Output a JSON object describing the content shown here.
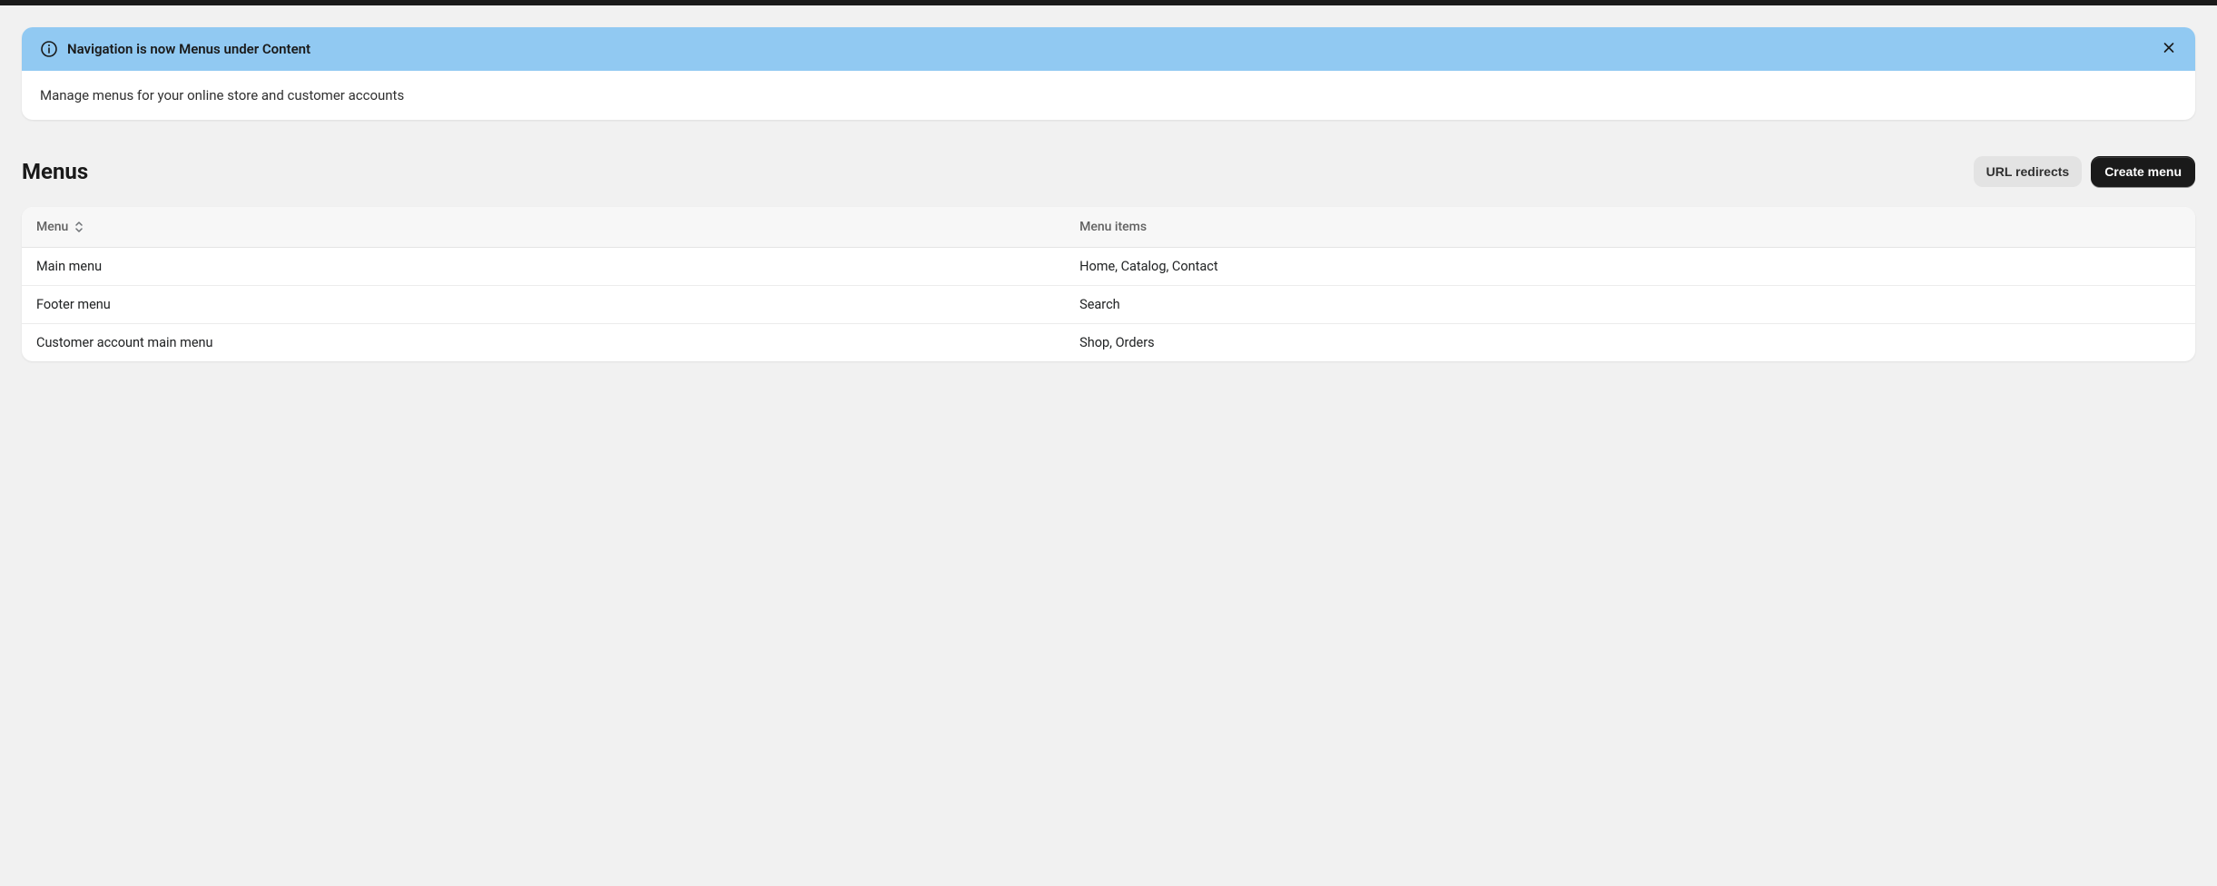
{
  "banner": {
    "title": "Navigation is now Menus under Content",
    "body": "Manage menus for your online store and customer accounts"
  },
  "page": {
    "title": "Menus"
  },
  "actions": {
    "url_redirects": "URL redirects",
    "create_menu": "Create menu"
  },
  "table": {
    "columns": {
      "menu": "Menu",
      "menu_items": "Menu items"
    },
    "rows": [
      {
        "menu": "Main menu",
        "items": "Home, Catalog, Contact"
      },
      {
        "menu": "Footer menu",
        "items": "Search"
      },
      {
        "menu": "Customer account main menu",
        "items": "Shop, Orders"
      }
    ]
  }
}
